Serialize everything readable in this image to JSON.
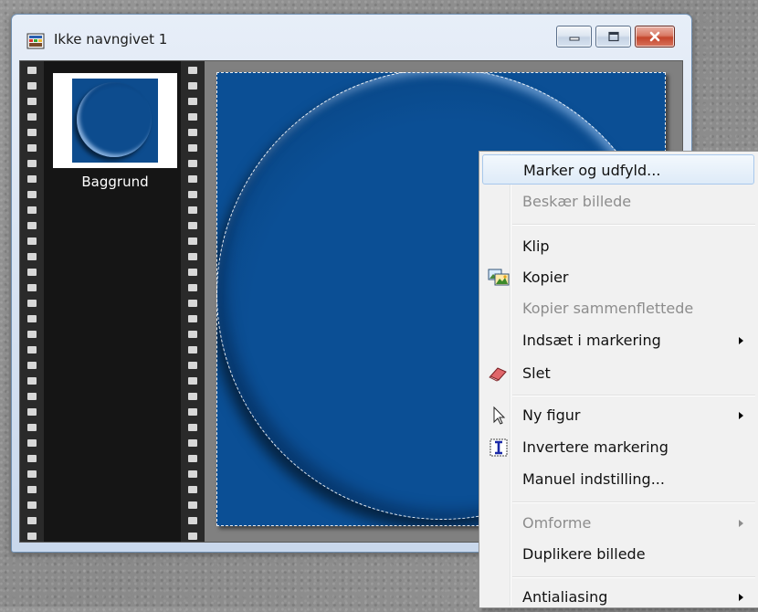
{
  "window": {
    "title": "Ikke navngivet 1",
    "icons": {
      "app": "image-document-icon",
      "minimize": "minimize-icon",
      "maximize": "maximize-icon",
      "close": "close-icon"
    }
  },
  "layers": {
    "items": [
      {
        "name": "Baggrund",
        "thumbnail": "blue-circle-thumbnail"
      }
    ]
  },
  "canvas": {
    "background_color": "#0b4f95",
    "selection": "ellipse"
  },
  "context_menu": {
    "items": [
      {
        "label": "Marker og udfyld...",
        "state": "highlighted"
      },
      {
        "label": "Beskær billede",
        "state": "disabled"
      },
      {
        "label": "Klip",
        "state": "enabled"
      },
      {
        "label": "Kopier",
        "state": "enabled",
        "icon": "copy-picture-icon"
      },
      {
        "label": "Kopier sammenflettede",
        "state": "disabled"
      },
      {
        "label": "Indsæt i markering",
        "state": "enabled",
        "submenu": true
      },
      {
        "label": "Slet",
        "state": "enabled",
        "icon": "eraser-icon"
      },
      {
        "label": "Ny figur",
        "state": "enabled",
        "submenu": true,
        "icon": "arrow-cursor-icon"
      },
      {
        "label": "Invertere markering",
        "state": "enabled",
        "icon": "invert-selection-icon"
      },
      {
        "label": "Manuel indstilling...",
        "state": "enabled"
      },
      {
        "label": "Omforme",
        "state": "disabled",
        "submenu": true
      },
      {
        "label": "Duplikere billede",
        "state": "enabled"
      },
      {
        "label": "Antialiasing",
        "state": "enabled",
        "submenu": true
      }
    ]
  },
  "colors": {
    "canvas_blue": "#0b4f95",
    "menu_highlight_border": "#a8c8ec",
    "close_button_red": "#c4452c",
    "disabled_text": "#8d8d8d"
  }
}
